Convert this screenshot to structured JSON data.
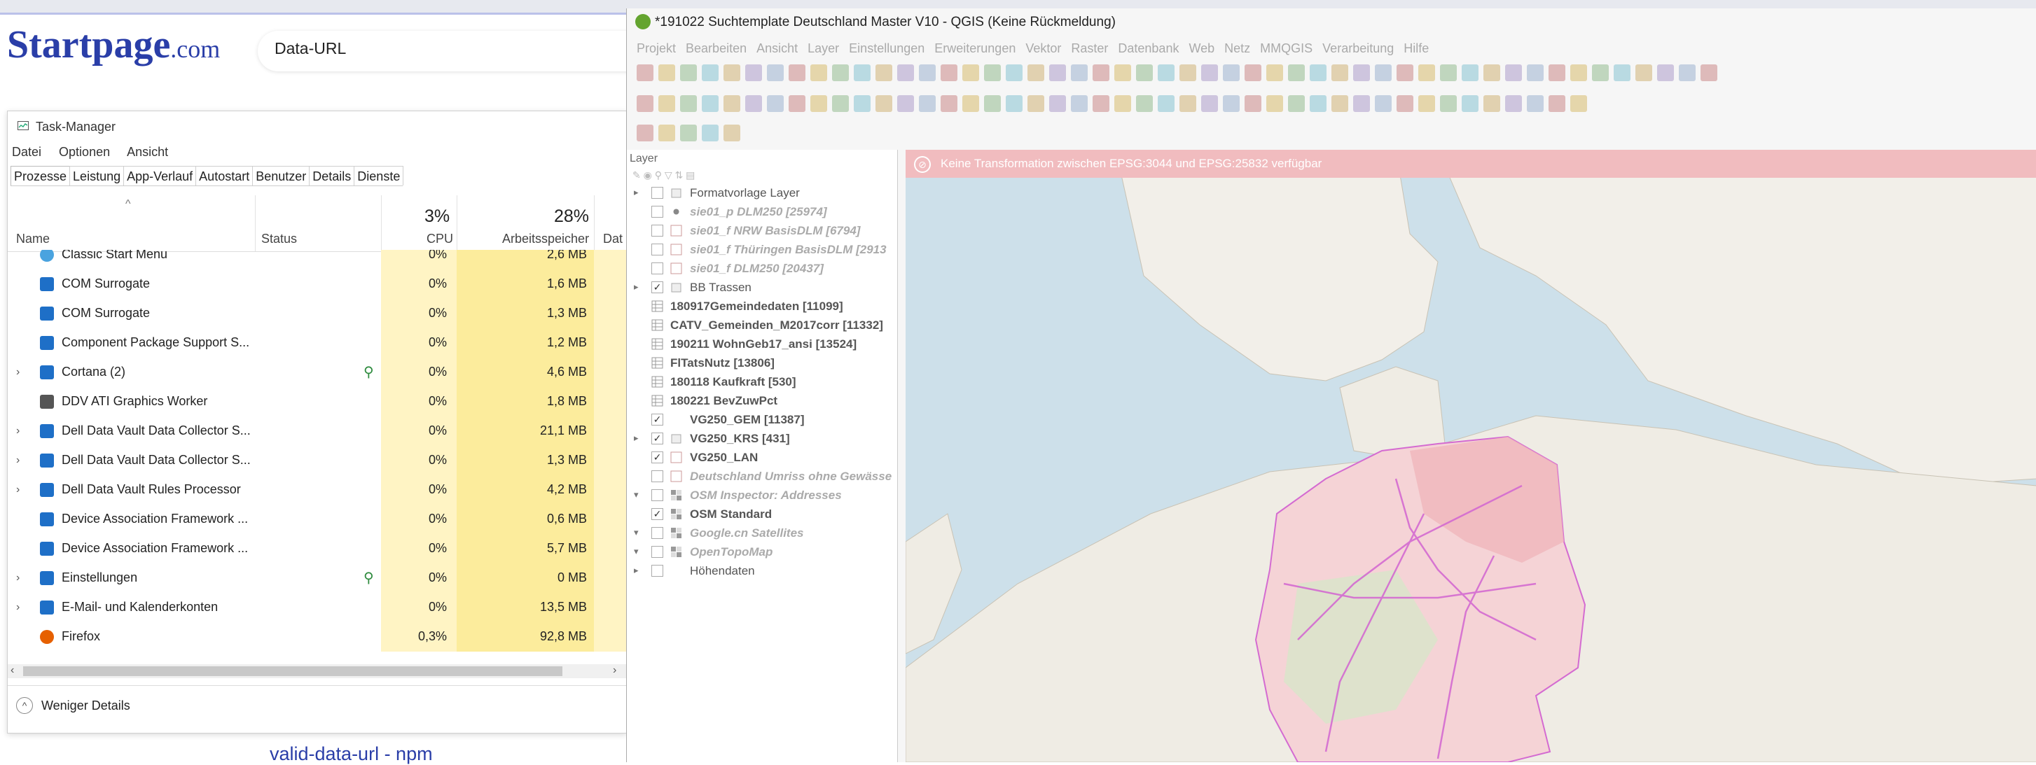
{
  "browser": {
    "logo_text": "Startpage",
    "logo_suffix": ".com",
    "search_value": "Data-URL",
    "result_link": "valid-data-url - npm"
  },
  "taskmgr": {
    "title": "Task-Manager",
    "menu": [
      "Datei",
      "Optionen",
      "Ansicht"
    ],
    "tabs": [
      "Prozesse",
      "Leistung",
      "App-Verlauf",
      "Autostart",
      "Benutzer",
      "Details",
      "Dienste"
    ],
    "columns": {
      "name": "Name",
      "status": "Status",
      "cpu_pct": "3%",
      "cpu": "CPU",
      "mem_pct": "28%",
      "mem": "Arbeitsspeicher",
      "disk": "Dat"
    },
    "rows": [
      {
        "name": "Classic Start Menu",
        "cpu": "0%",
        "mem": "2,6 MB",
        "expand": false,
        "leaf": false,
        "icon": "shell-icon"
      },
      {
        "name": "COM Surrogate",
        "cpu": "0%",
        "mem": "1,6 MB",
        "expand": false,
        "leaf": false,
        "icon": "app-window-icon"
      },
      {
        "name": "COM Surrogate",
        "cpu": "0%",
        "mem": "1,3 MB",
        "expand": false,
        "leaf": false,
        "icon": "app-window-icon"
      },
      {
        "name": "Component Package Support S...",
        "cpu": "0%",
        "mem": "1,2 MB",
        "expand": false,
        "leaf": false,
        "icon": "app-window-icon"
      },
      {
        "name": "Cortana (2)",
        "cpu": "0%",
        "mem": "4,6 MB",
        "expand": true,
        "leaf": true,
        "icon": "cortana-icon"
      },
      {
        "name": "DDV ATI Graphics Worker",
        "cpu": "0%",
        "mem": "1,8 MB",
        "expand": false,
        "leaf": false,
        "icon": "ddv-icon"
      },
      {
        "name": "Dell Data Vault Data Collector S...",
        "cpu": "0%",
        "mem": "21,1 MB",
        "expand": true,
        "leaf": false,
        "icon": "app-window-icon"
      },
      {
        "name": "Dell Data Vault Data Collector S...",
        "cpu": "0%",
        "mem": "1,3 MB",
        "expand": true,
        "leaf": false,
        "icon": "app-window-icon"
      },
      {
        "name": "Dell Data Vault Rules Processor",
        "cpu": "0%",
        "mem": "4,2 MB",
        "expand": true,
        "leaf": false,
        "icon": "app-window-icon"
      },
      {
        "name": "Device Association Framework ...",
        "cpu": "0%",
        "mem": "0,6 MB",
        "expand": false,
        "leaf": false,
        "icon": "app-window-icon"
      },
      {
        "name": "Device Association Framework ...",
        "cpu": "0%",
        "mem": "5,7 MB",
        "expand": false,
        "leaf": false,
        "icon": "app-window-icon"
      },
      {
        "name": "Einstellungen",
        "cpu": "0%",
        "mem": "0 MB",
        "expand": true,
        "leaf": true,
        "icon": "settings-icon"
      },
      {
        "name": "E-Mail- und Kalenderkonten",
        "cpu": "0%",
        "mem": "13,5 MB",
        "expand": true,
        "leaf": false,
        "icon": "settings-icon"
      },
      {
        "name": "Firefox",
        "cpu": "0,3%",
        "mem": "92,8 MB",
        "expand": false,
        "leaf": false,
        "icon": "firefox-icon"
      }
    ],
    "fewer_details": "Weniger Details"
  },
  "qgis": {
    "title": "*191022 Suchtemplate Deutschland Master V10 - QGIS (Keine Rückmeldung)",
    "menu": [
      "Projekt",
      "Bearbeiten",
      "Ansicht",
      "Layer",
      "Einstellungen",
      "Erweiterungen",
      "Vektor",
      "Raster",
      "Datenbank",
      "Web",
      "Netz",
      "MMQGIS",
      "Verarbeitung",
      "Hilfe"
    ],
    "layer_panel_title": "Layer",
    "message": "Keine Transformation zwischen EPSG:3044 und EPSG:25832 verfügbar",
    "layers": [
      {
        "name": "Formatvorlage Layer",
        "style": "normal",
        "arrow": "▸",
        "checked": false,
        "sym": "group"
      },
      {
        "name": "sie01_p DLM250 [25974]",
        "style": "grey",
        "arrow": "",
        "checked": false,
        "sym": "point"
      },
      {
        "name": "sie01_f NRW BasisDLM [6794]",
        "style": "grey",
        "arrow": "",
        "checked": false,
        "sym": "poly"
      },
      {
        "name": "sie01_f Thüringen BasisDLM [2913",
        "style": "grey",
        "arrow": "",
        "checked": false,
        "sym": "poly"
      },
      {
        "name": "sie01_f  DLM250 [20437]",
        "style": "grey",
        "arrow": "",
        "checked": false,
        "sym": "poly"
      },
      {
        "name": "BB Trassen",
        "style": "normal",
        "arrow": "▸",
        "checked": true,
        "sym": "group"
      },
      {
        "name": "180917Gemeindedaten [11099]",
        "style": "bold",
        "arrow": "",
        "checked": null,
        "sym": "table"
      },
      {
        "name": "CATV_Gemeinden_M2017corr [11332]",
        "style": "bold",
        "arrow": "",
        "checked": null,
        "sym": "table"
      },
      {
        "name": "190211 WohnGeb17_ansi [13524]",
        "style": "bold",
        "arrow": "",
        "checked": null,
        "sym": "table"
      },
      {
        "name": "FlTatsNutz [13806]",
        "style": "bold",
        "arrow": "",
        "checked": null,
        "sym": "table"
      },
      {
        "name": "180118 Kaufkraft [530]",
        "style": "bold",
        "arrow": "",
        "checked": null,
        "sym": "table"
      },
      {
        "name": "180221 BevZuwPct",
        "style": "bold",
        "arrow": "",
        "checked": null,
        "sym": "table"
      },
      {
        "name": "VG250_GEM [11387]",
        "style": "bold",
        "arrow": "",
        "checked": true,
        "sym": "none"
      },
      {
        "name": "VG250_KRS [431]",
        "style": "bold",
        "arrow": "▸",
        "checked": true,
        "sym": "group"
      },
      {
        "name": "VG250_LAN",
        "style": "bold",
        "arrow": "",
        "checked": true,
        "sym": "poly"
      },
      {
        "name": "Deutschland Umriss ohne Gewässe",
        "style": "grey",
        "arrow": "",
        "checked": false,
        "sym": "poly"
      },
      {
        "name": "OSM Inspector: Addresses",
        "style": "grey",
        "arrow": "▾",
        "checked": false,
        "sym": "raster"
      },
      {
        "name": "OSM Standard",
        "style": "bold",
        "arrow": "",
        "checked": true,
        "sym": "raster"
      },
      {
        "name": "Google.cn Satellites",
        "style": "grey",
        "arrow": "▾",
        "checked": false,
        "sym": "raster"
      },
      {
        "name": "OpenTopoMap",
        "style": "grey",
        "arrow": "▾",
        "checked": false,
        "sym": "raster"
      },
      {
        "name": "Höhendaten",
        "style": "normal",
        "arrow": "▸",
        "checked": false,
        "sym": "none"
      }
    ]
  }
}
